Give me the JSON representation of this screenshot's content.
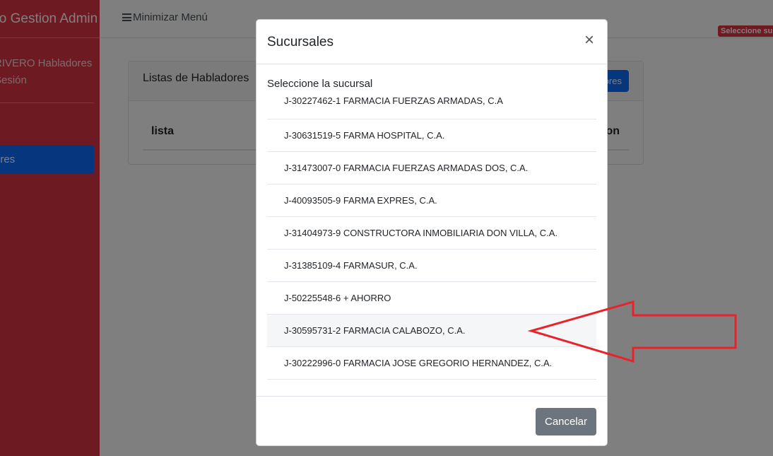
{
  "sidebar": {
    "brand": "olo Gestion Admin",
    "user_line1": "RIVERO Habladores",
    "user_line2": "Sesión",
    "active_item": "ores"
  },
  "topbar": {
    "toggle_label": "Minimizar Menú",
    "badge": "Seleccione su"
  },
  "card": {
    "title": "Listas de Habladores",
    "button": "ores",
    "columns": [
      "lista",
      "on"
    ]
  },
  "modal": {
    "title": "Sucursales",
    "close_glyph": "×",
    "prompt": "Seleccione la sucursal",
    "items": [
      "J-30227462-1 FARMACIA FUERZAS ARMADAS, C.A",
      "J-30631519-5 FARMA HOSPITAL, C.A.",
      "J-31473007-0 FARMACIA FUERZAS ARMADAS DOS, C.A.",
      "J-40093505-9 FARMA EXPRES, C.A.",
      "J-31404973-9 CONSTRUCTORA INMOBILIARIA DON VILLA, C.A.",
      "J-31385109-4 FARMASUR, C.A.",
      "J-50225548-6 + AHORRO",
      "J-30595731-2 FARMACIA CALABOZO, C.A.",
      "J-30222996-0 FARMACIA JOSE GREGORIO HERNANDEZ, C.A."
    ],
    "cancel_label": "Cancelar"
  },
  "colors": {
    "sidebar": "#dc3545",
    "primary": "#0d6efd",
    "secondary": "#6c757d",
    "annotation_arrow": "#e8232c"
  },
  "icons": {
    "menu_toggle": "hamburger-icon",
    "close": "close-icon"
  }
}
